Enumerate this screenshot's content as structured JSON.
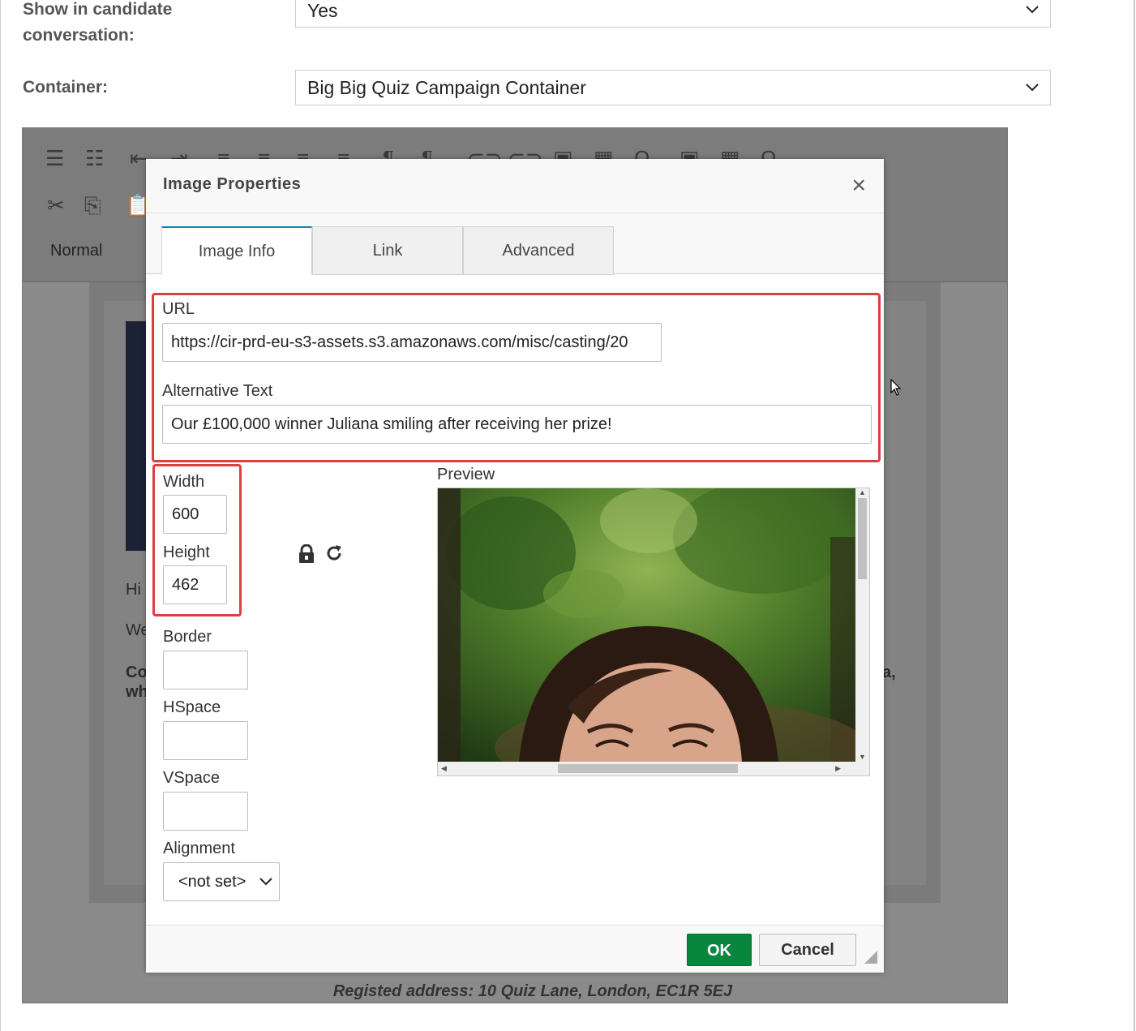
{
  "form": {
    "show_label_line1": "Show in candidate",
    "show_label_line2": "conversation:",
    "show_value": "Yes",
    "container_label": "Container:",
    "container_value": "Big Big Quiz Campaign Container"
  },
  "editor": {
    "format_value": "Normal",
    "fragments": {
      "hi": "Hi",
      "we": "We",
      "co": "Co",
      "wh": "wh",
      "a": "a,"
    },
    "footer": "Registed address: 10 Quiz Lane, London, EC1R 5EJ"
  },
  "dialog": {
    "title": "Image Properties",
    "close": "×",
    "tabs": [
      {
        "label": "Image Info",
        "active": true
      },
      {
        "label": "Link",
        "active": false
      },
      {
        "label": "Advanced",
        "active": false
      }
    ],
    "url_label": "URL",
    "url_value": "https://cir-prd-eu-s3-assets.s3.amazonaws.com/misc/casting/20",
    "alt_label": "Alternative Text",
    "alt_value": "Our £100,000 winner Juliana smiling after receiving her prize!",
    "width_label": "Width",
    "width_value": "600",
    "height_label": "Height",
    "height_value": "462",
    "border_label": "Border",
    "border_value": "",
    "hspace_label": "HSpace",
    "hspace_value": "",
    "vspace_label": "VSpace",
    "vspace_value": "",
    "alignment_label": "Alignment",
    "alignment_value": "<not set>",
    "preview_label": "Preview",
    "ok": "OK",
    "cancel": "Cancel"
  },
  "colors": {
    "ok_button": "#09863e",
    "highlight": "#d94141",
    "active_tab": "#0e7fc1"
  }
}
